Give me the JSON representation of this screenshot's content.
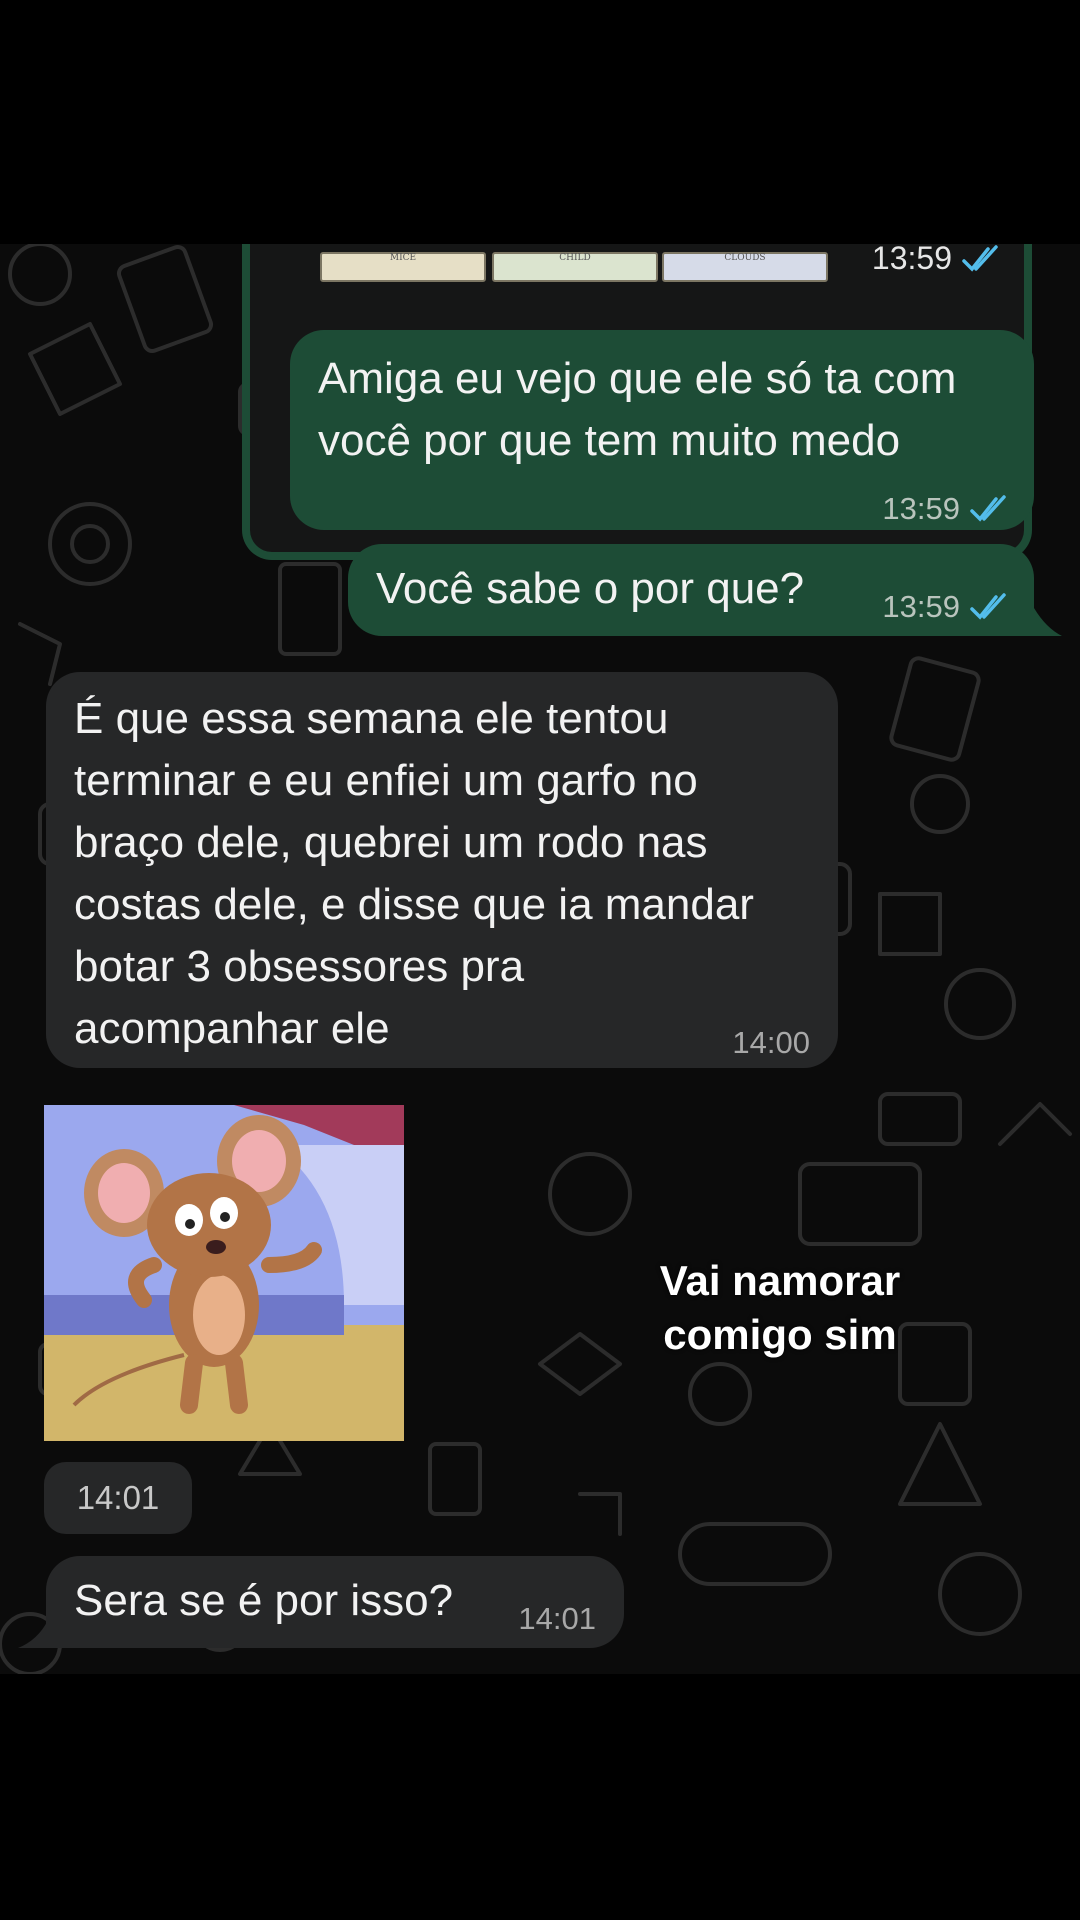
{
  "messages": {
    "image_top": {
      "cards": [
        "MICE",
        "CHILD",
        "CLOUDS"
      ],
      "time": "13:59"
    },
    "out1": {
      "text": "Amiga eu vejo que ele só ta com\nvocê por que tem muito medo",
      "time": "13:59"
    },
    "out2": {
      "text": "Você sabe o por que?",
      "time": "13:59"
    },
    "in1": {
      "text": "É que essa semana ele tentou\nterminar e eu enfiei um garfo no\nbraço dele, quebrei um rodo nas\ncostas dele, e disse que ia mandar\nbotar 3 obsessores pra\nacompanhar ele",
      "time": "14:00"
    },
    "sticker": {
      "caption_line1": "Vai namorar",
      "caption_line2": "comigo sim",
      "time": "14:01"
    },
    "in2": {
      "text": "Sera se é por isso?",
      "time": "14:01"
    }
  },
  "colors": {
    "outgoing_bubble": "#1d4c36",
    "incoming_bubble": "#262728",
    "read_ticks": "#53bdeb",
    "background": "#0b0b0b"
  },
  "icons": [
    "double-check-read-icon",
    "chat-wallpaper-doodles"
  ]
}
